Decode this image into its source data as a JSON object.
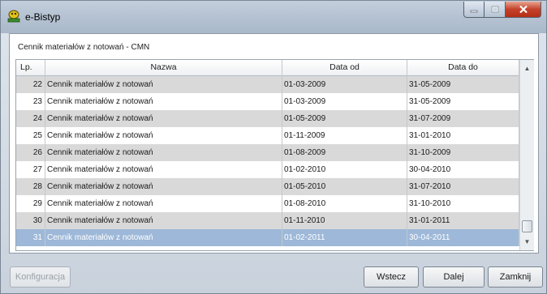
{
  "window": {
    "title": "e-Bistyp"
  },
  "subtitle": "Cennik materiałów z notowań -  CMN",
  "table": {
    "headers": [
      "Lp.",
      "Nazwa",
      "Data od",
      "Data do"
    ],
    "rows": [
      [
        "22",
        "Cennik materiałów z notowań",
        "01-03-2009",
        "31-05-2009"
      ],
      [
        "23",
        "Cennik materiałów z notowań",
        "01-03-2009",
        "31-05-2009"
      ],
      [
        "24",
        "Cennik materiałów z notowań",
        "01-05-2009",
        "31-07-2009"
      ],
      [
        "25",
        "Cennik materiałów z notowań",
        "01-11-2009",
        "31-01-2010"
      ],
      [
        "26",
        "Cennik materiałów z notowań",
        "01-08-2009",
        "31-10-2009"
      ],
      [
        "27",
        "Cennik materiałów z notowań",
        "01-02-2010",
        "30-04-2010"
      ],
      [
        "28",
        "Cennik materiałów z notowań",
        "01-05-2010",
        "31-07-2010"
      ],
      [
        "29",
        "Cennik materiałów z notowań",
        "01-08-2010",
        "31-10-2010"
      ],
      [
        "30",
        "Cennik materiałów z notowań",
        "01-11-2010",
        "31-01-2011"
      ],
      [
        "31",
        "Cennik materiałów z notowań",
        "01-02-2011",
        "30-04-2011"
      ]
    ],
    "selected_index": 9
  },
  "buttons": {
    "config": "Konfiguracja",
    "back": "Wstecz",
    "next": "Dalej",
    "close": "Zamknij"
  },
  "icons": {
    "app": "app-icon",
    "minimize": "minimize-icon",
    "maximize": "maximize-icon",
    "close": "close-icon",
    "scroll_up": "scroll-up-icon",
    "scroll_down": "scroll-down-icon"
  },
  "colors": {
    "selected_row": "#9db8d8",
    "alt_row": "#d9d9d9",
    "close_button": "#c4412a"
  }
}
